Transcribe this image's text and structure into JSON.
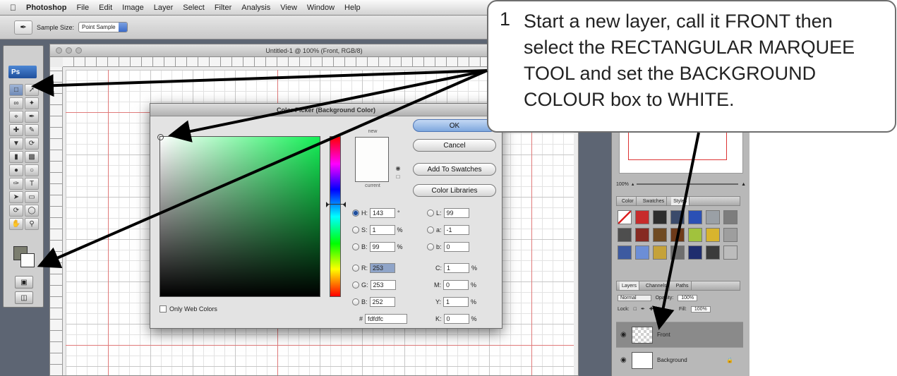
{
  "menubar": {
    "app": "Photoshop",
    "items": [
      "File",
      "Edit",
      "Image",
      "Layer",
      "Select",
      "Filter",
      "Analysis",
      "View",
      "Window",
      "Help"
    ]
  },
  "options_bar": {
    "sample_size_label": "Sample Size:",
    "sample_size_value": "Point Sample"
  },
  "tools": {
    "logo": "Ps"
  },
  "document": {
    "title": "Untitled-1 @ 100% (Front, RGB/8)"
  },
  "color_picker": {
    "title": "Color Picker (Background Color)",
    "new_label": "new",
    "current_label": "current",
    "buttons": {
      "ok": "OK",
      "cancel": "Cancel",
      "add_to_swatches": "Add To Swatches",
      "color_libraries": "Color Libraries"
    },
    "fields": {
      "h": {
        "label": "H:",
        "value": "143",
        "unit": "°"
      },
      "s": {
        "label": "S:",
        "value": "1",
        "unit": "%"
      },
      "b": {
        "label": "B:",
        "value": "99",
        "unit": "%"
      },
      "r": {
        "label": "R:",
        "value": "253"
      },
      "g": {
        "label": "G:",
        "value": "253"
      },
      "bl": {
        "label": "B:",
        "value": "252"
      },
      "l": {
        "label": "L:",
        "value": "99"
      },
      "a": {
        "label": "a:",
        "value": "-1"
      },
      "lab_b": {
        "label": "b:",
        "value": "0"
      },
      "c": {
        "label": "C:",
        "value": "1",
        "unit": "%"
      },
      "m": {
        "label": "M:",
        "value": "0",
        "unit": "%"
      },
      "y": {
        "label": "Y:",
        "value": "1",
        "unit": "%"
      },
      "k": {
        "label": "K:",
        "value": "0",
        "unit": "%"
      },
      "hex": {
        "label": "#",
        "value": "fdfdfc"
      }
    },
    "only_web_colors": "Only Web Colors",
    "selected_color": "#fdfdfc"
  },
  "panels": {
    "zoom": "100%",
    "style_tabs": [
      "Color",
      "Swatches",
      "Styles"
    ],
    "layer_tabs": [
      "Layers",
      "Channels",
      "Paths"
    ],
    "blend_mode": "Normal",
    "opacity_label": "Opacity:",
    "opacity_value": "100%",
    "lock_label": "Lock:",
    "fill_label": "Fill:",
    "fill_value": "100%",
    "layers": [
      {
        "name": "Front"
      },
      {
        "name": "Background"
      }
    ]
  },
  "callout": {
    "step": "1",
    "text": "Start a new layer, call it FRONT then select the RECTANGULAR MARQUEE TOOL and set the BACKGROUND COLOUR box to WHITE."
  }
}
